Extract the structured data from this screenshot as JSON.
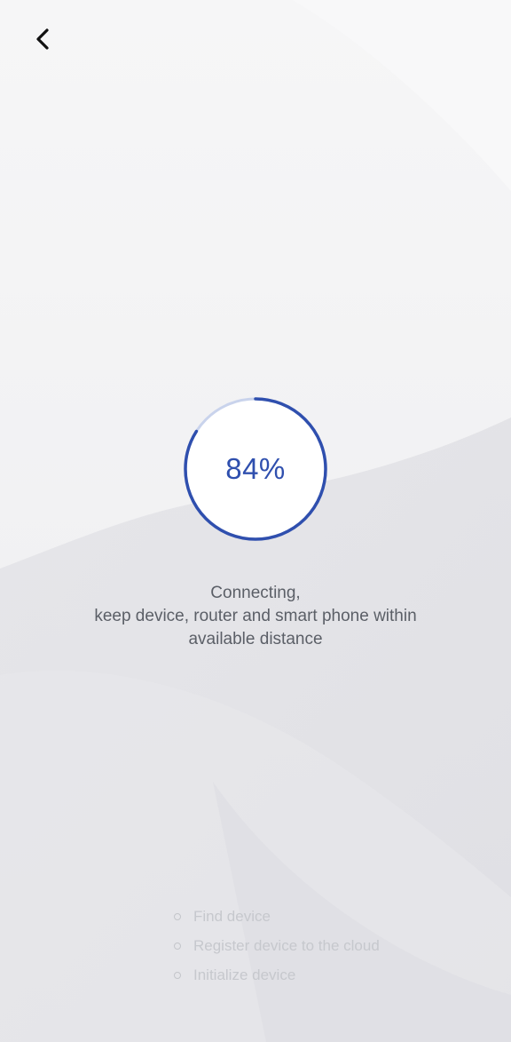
{
  "header": {
    "back_icon": "chevron-left-icon"
  },
  "progress": {
    "value": 0.84,
    "label": "84%",
    "ring_color": "#2f4fae",
    "track_color": "#c9d3ec"
  },
  "status": {
    "line1": "Connecting,",
    "line2": "keep device, router and smart phone within",
    "line3": "available distance"
  },
  "steps": [
    {
      "label": "Find device"
    },
    {
      "label": "Register device to the cloud"
    },
    {
      "label": "Initialize device"
    }
  ]
}
